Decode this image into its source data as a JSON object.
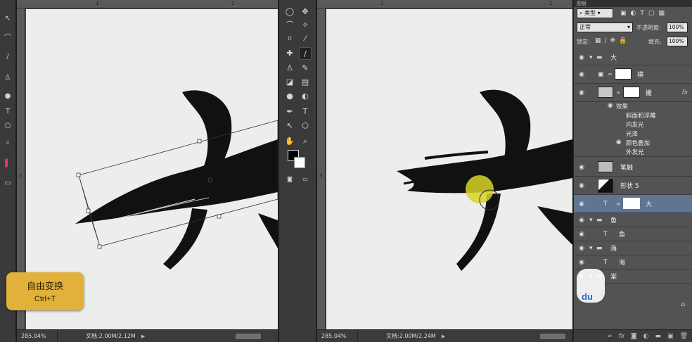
{
  "left_doc": {
    "zoom": "285.04%",
    "doc_info": "文档:2.00M/2.12M",
    "ruler_top": [
      "1",
      "2"
    ],
    "ruler_side": "3"
  },
  "right_doc": {
    "zoom": "285.04%",
    "doc_info": "文档:2.00M/2.24M",
    "ruler_top": [
      "1",
      "2"
    ],
    "ruler_side": "3"
  },
  "badge": {
    "title": "自由变换",
    "shortcut": "Ctrl+T",
    "color": "#e2b13a"
  },
  "layers_panel": {
    "tab_label": "图层",
    "filter_label": "类型",
    "blend_mode": "正常",
    "opacity_label": "不透明度:",
    "opacity_value": "100%",
    "lock_label": "锁定:",
    "fill_label": "填充:",
    "fill_value": "100%",
    "selected_color": "#5f7592",
    "layers": [
      {
        "name": "大",
        "kind": "group"
      },
      {
        "name": "横",
        "kind": "masked-layer"
      },
      {
        "name": "撇",
        "kind": "layer-fx"
      },
      {
        "name": "效果",
        "kind": "effects-header"
      },
      {
        "name": "斜面和浮雕",
        "kind": "effect"
      },
      {
        "name": "内发光",
        "kind": "effect"
      },
      {
        "name": "光泽",
        "kind": "effect"
      },
      {
        "name": "颜色叠加",
        "kind": "effect"
      },
      {
        "name": "外发光",
        "kind": "effect"
      },
      {
        "name": "笔触",
        "kind": "layer"
      },
      {
        "name": "形状 5",
        "kind": "layer"
      },
      {
        "name": "大",
        "kind": "text-selected"
      },
      {
        "name": "鱼",
        "kind": "group"
      },
      {
        "name": "鱼",
        "kind": "text"
      },
      {
        "name": "海",
        "kind": "group"
      },
      {
        "name": "海",
        "kind": "text"
      },
      {
        "name": "棠",
        "kind": "group"
      }
    ],
    "fx_label": "fx"
  },
  "icons": {
    "eye": "eye-icon",
    "folder": "folder-icon",
    "text_layer": "text-layer-icon",
    "chain": "chain-icon",
    "cursor_highlight": "yellow-cursor-highlight"
  },
  "watermark": "du"
}
